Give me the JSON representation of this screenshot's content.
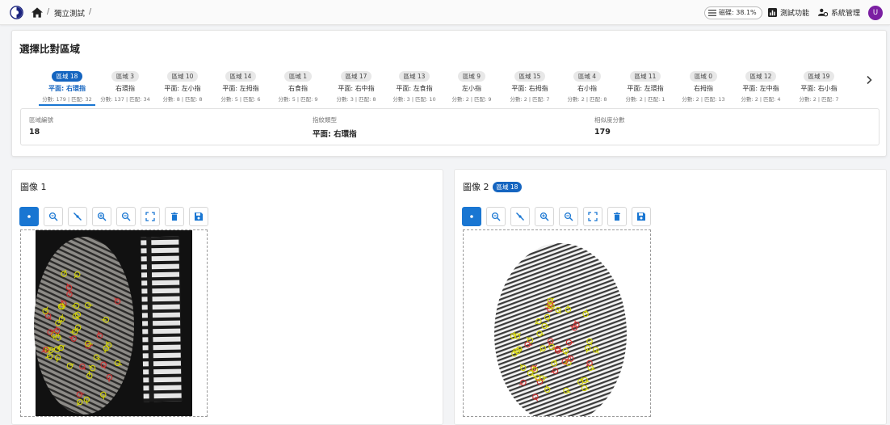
{
  "topbar": {
    "breadcrumb_sep_1": "/",
    "breadcrumb_item": "獨立測試",
    "breadcrumb_sep_2": "/",
    "disk_label": "磁碟: 38.1%",
    "test_feature": "測試功能",
    "system_admin": "系統管理",
    "user_initial": "U"
  },
  "region": {
    "title": "選擇比對區域",
    "tabs": [
      {
        "chip": "區域 18",
        "name": "平面: 右環指",
        "score": "分數: 179 | 匹配: 32",
        "active": true
      },
      {
        "chip": "區域 3",
        "name": "右環指",
        "score": "分數: 137 | 匹配: 34"
      },
      {
        "chip": "區域 10",
        "name": "平面: 左小指",
        "score": "分數: 8 | 匹配: 8"
      },
      {
        "chip": "區域 14",
        "name": "平面: 左拇指",
        "score": "分數: 5 | 匹配: 6"
      },
      {
        "chip": "區域 1",
        "name": "右食指",
        "score": "分數: 5 | 匹配: 9"
      },
      {
        "chip": "區域 17",
        "name": "平面: 右中指",
        "score": "分數: 3 | 匹配: 8"
      },
      {
        "chip": "區域 13",
        "name": "平面: 左食指",
        "score": "分數: 3 | 匹配: 10"
      },
      {
        "chip": "區域 9",
        "name": "左小指",
        "score": "分數: 2 | 匹配: 9"
      },
      {
        "chip": "區域 15",
        "name": "平面: 右拇指",
        "score": "分數: 2 | 匹配: 7"
      },
      {
        "chip": "區域 4",
        "name": "右小指",
        "score": "分數: 2 | 匹配: 8"
      },
      {
        "chip": "區域 11",
        "name": "平面: 左環指",
        "score": "分數: 2 | 匹配: 1"
      },
      {
        "chip": "區域 0",
        "name": "右拇指",
        "score": "分數: 2 | 匹配: 13"
      },
      {
        "chip": "區域 12",
        "name": "平面: 左中指",
        "score": "分數: 2 | 匹配: 4"
      },
      {
        "chip": "區域 19",
        "name": "平面: 右小指",
        "score": "分數: 2 | 匹配: 7"
      }
    ],
    "info": {
      "region_number_label": "區域編號",
      "region_number_value": "18",
      "print_type_label": "指紋類型",
      "print_type_value": "平面: 右環指",
      "similarity_label": "相似度分數",
      "similarity_value": "179"
    }
  },
  "image1": {
    "title": "圖像 1"
  },
  "image2": {
    "title": "圖像 2",
    "badge": "區域 18"
  },
  "toolbar_icons": [
    "eye-icon",
    "search-minutiae-icon",
    "eye-off-icon",
    "zoom-in-icon",
    "zoom-out-icon",
    "fit-screen-icon",
    "delete-icon",
    "save-icon"
  ],
  "colors": {
    "accent": "#1976d2",
    "accent_dark": "#1565c0",
    "avatar": "#7b1fa2",
    "minutia_match": "#d4d400",
    "minutia_unmatched": "#d32f2f"
  }
}
